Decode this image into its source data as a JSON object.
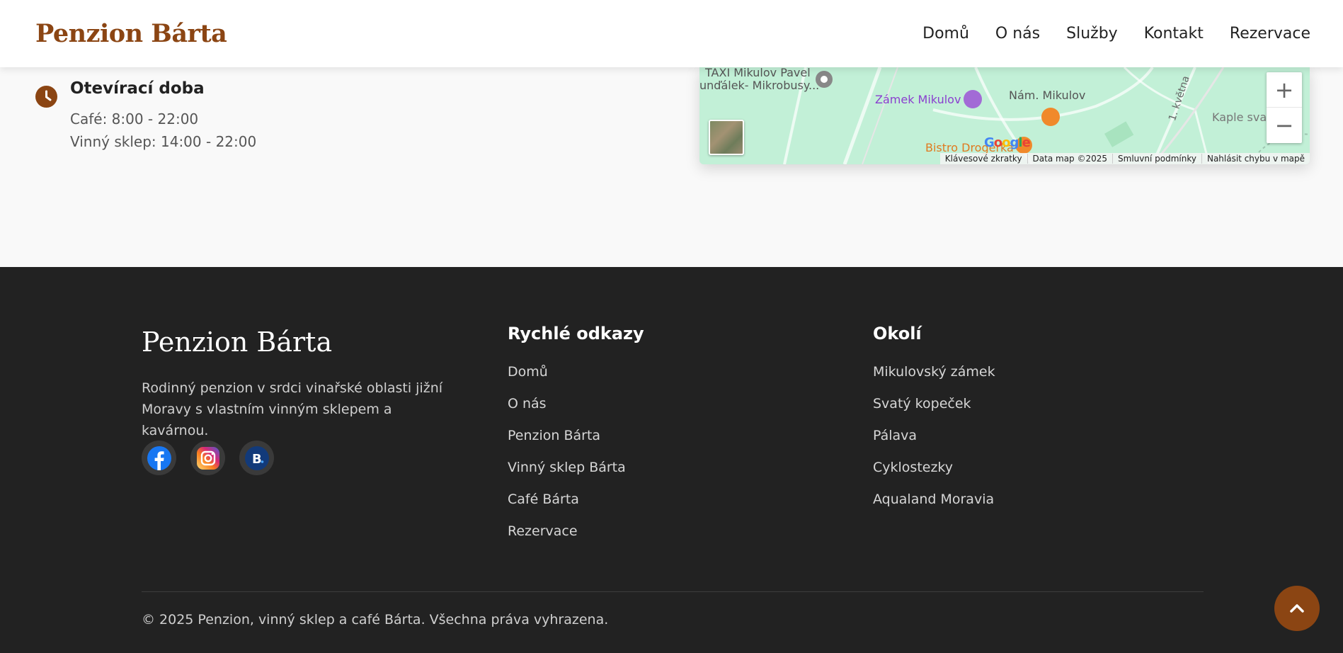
{
  "header": {
    "brand": "Penzion Bárta",
    "nav": [
      "Domů",
      "O nás",
      "Služby",
      "Kontakt",
      "Rezervace"
    ]
  },
  "hours": {
    "title": "Otevírací doba",
    "lines": [
      "Café: 8:00 - 22:00",
      "Vinný sklep: 14:00 - 22:00"
    ]
  },
  "map": {
    "labels": [
      "TAXI Mikulov Pavel",
      "unďálek- Mikrobusy...",
      "Zámek Mikulov",
      "Nám. Mikulov",
      "Kaple svat",
      "Bistro Drogerka",
      "1. května"
    ],
    "google": "Google",
    "attribution": [
      "Klávesové zkratky",
      "Data map ©2025",
      "Smluvní podmínky",
      "Nahlásit chybu v mapě"
    ],
    "zoom_in": "+",
    "zoom_out": "−"
  },
  "footer": {
    "brand": "Penzion Bárta",
    "description": "Rodinný penzion v srdci vinařské oblasti jižní Moravy s vlastním vinným sklepem a kavárnou.",
    "social": [
      "facebook-icon",
      "instagram-icon",
      "booking-icon"
    ],
    "quick_links": {
      "title": "Rychlé odkazy",
      "items": [
        "Domů",
        "O nás",
        "Penzion Bárta",
        "Vinný sklep Bárta",
        "Café Bárta",
        "Rezervace"
      ]
    },
    "surroundings": {
      "title": "Okolí",
      "items": [
        "Mikulovský zámek",
        "Svatý kopeček",
        "Pálava",
        "Cyklostezky",
        "Aqualand Moravia"
      ]
    },
    "copyright": "© 2025 Penzion, vinný sklep a café Bárta. Všechna práva vyhrazena."
  },
  "colors": {
    "brand": "#8b4513",
    "footer_bg": "#222222",
    "map_bg": "#c2f0d7"
  }
}
